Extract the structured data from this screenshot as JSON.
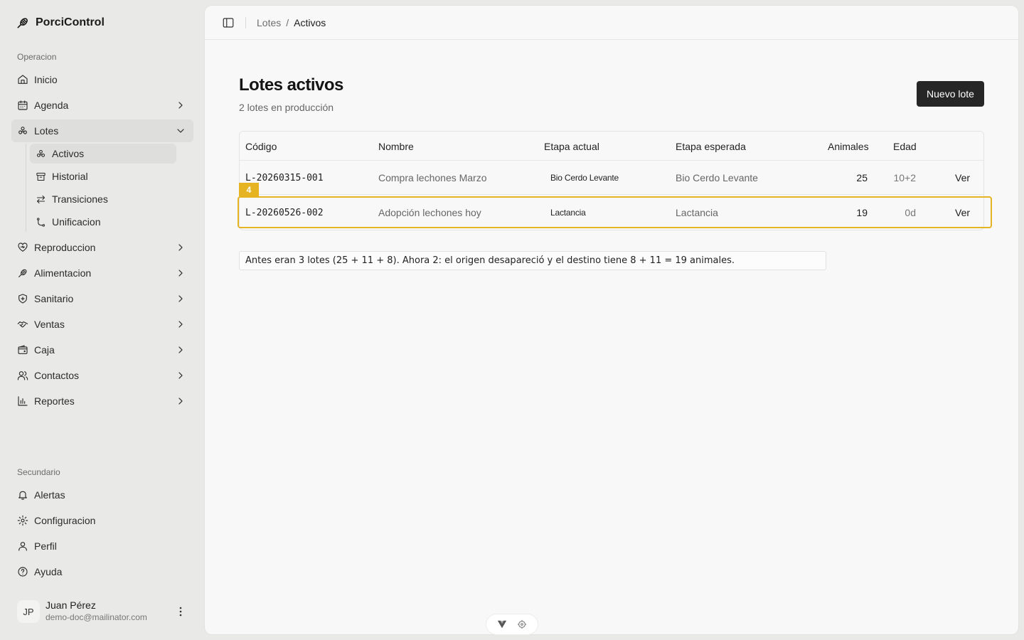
{
  "app": {
    "name": "PorciControl"
  },
  "sidebar": {
    "group_primary": "Operacion",
    "items": [
      {
        "label": "Inicio",
        "icon": "home-icon"
      },
      {
        "label": "Agenda",
        "icon": "calendar-icon"
      },
      {
        "label": "Lotes",
        "icon": "lotes-icon"
      },
      {
        "label": "Reproduccion",
        "icon": "heart-icon"
      },
      {
        "label": "Alimentacion",
        "icon": "feed-icon"
      },
      {
        "label": "Sanitario",
        "icon": "shield-icon"
      },
      {
        "label": "Ventas",
        "icon": "handshake-icon"
      },
      {
        "label": "Caja",
        "icon": "wallet-icon"
      },
      {
        "label": "Contactos",
        "icon": "users-icon"
      },
      {
        "label": "Reportes",
        "icon": "chart-icon"
      }
    ],
    "lotes_sub": [
      {
        "label": "Activos",
        "icon": "lotes-icon"
      },
      {
        "label": "Historial",
        "icon": "archive-icon"
      },
      {
        "label": "Transiciones",
        "icon": "arrows-icon"
      },
      {
        "label": "Unificacion",
        "icon": "merge-icon"
      }
    ],
    "group_secondary": "Secundario",
    "secondary": [
      {
        "label": "Alertas",
        "icon": "bell-icon"
      },
      {
        "label": "Configuracion",
        "icon": "gear-icon"
      },
      {
        "label": "Perfil",
        "icon": "user-icon"
      },
      {
        "label": "Ayuda",
        "icon": "help-icon"
      }
    ],
    "user": {
      "initials": "JP",
      "name": "Juan Pérez",
      "email": "demo-doc@mailinator.com"
    }
  },
  "breadcrumb": {
    "parent": "Lotes",
    "sep": "/",
    "current": "Activos"
  },
  "page": {
    "title": "Lotes activos",
    "subtitle": "2 lotes en producción",
    "new_button": "Nuevo lote"
  },
  "table": {
    "headers": [
      "Código",
      "Nombre",
      "Etapa actual",
      "Etapa esperada",
      "Animales",
      "Edad"
    ],
    "rows": [
      {
        "code": "L-20260315-001",
        "name": "Compra lechones Marzo",
        "stage": "Bio Cerdo Levante",
        "expected": "Bio Cerdo Levante",
        "animals": "25",
        "age": "10+2",
        "action": "Ver"
      },
      {
        "code": "L-20260526-002",
        "name": "Adopción lechones hoy",
        "stage": "Lactancia",
        "expected": "Lactancia",
        "animals": "19",
        "age": "0d",
        "action": "Ver"
      }
    ]
  },
  "highlight": {
    "tag": "4",
    "color": "#e6b422"
  },
  "note": "Antes eran 3 lotes (25 + 11 + 8). Ahora 2: el origen desapareció y el destino tiene 8 + 11 = 19 animales."
}
